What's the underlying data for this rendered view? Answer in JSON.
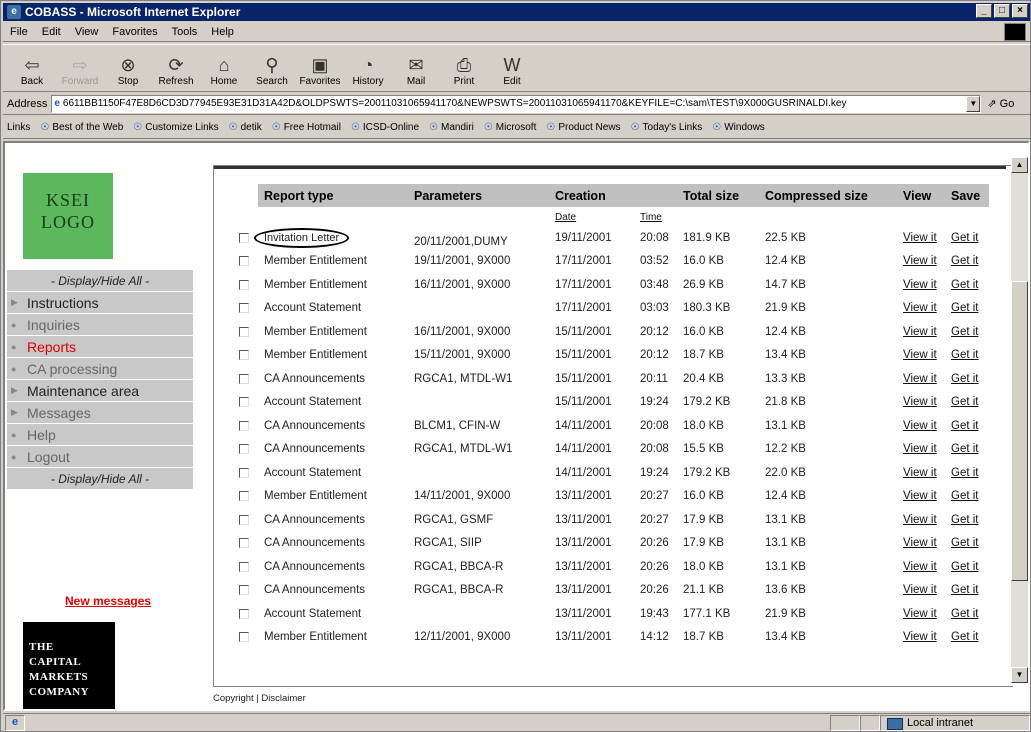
{
  "window": {
    "title": "COBASS - Microsoft Internet Explorer"
  },
  "menubar": [
    "File",
    "Edit",
    "View",
    "Favorites",
    "Tools",
    "Help"
  ],
  "toolbar": {
    "back": "Back",
    "forward": "Forward",
    "stop": "Stop",
    "refresh": "Refresh",
    "home": "Home",
    "search": "Search",
    "favorites": "Favorites",
    "history": "History",
    "mail": "Mail",
    "print": "Print",
    "edit": "Edit"
  },
  "address": {
    "label": "Address",
    "url": "6611BB1150F47E8D6CD3D77945E93E31D31A42D&OLDPSWTS=20011031065941170&NEWPSWTS=20011031065941170&KEYFILE=C:\\sam\\TEST\\9X000GUSRINALDI.key",
    "go": "Go"
  },
  "links": {
    "label": "Links",
    "items": [
      "Best of the Web",
      "Customize Links",
      "detik",
      "Free Hotmail",
      "ICSD-Online",
      "Mandiri",
      "Microsoft",
      "Product News",
      "Today's Links",
      "Windows"
    ]
  },
  "sidebar": {
    "logo": "KSEI LOGO",
    "display_hide_top": "- Display/Hide All -",
    "display_hide_bottom": "- Display/Hide All -",
    "items": [
      {
        "label": "Instructions",
        "bullet": "arrow"
      },
      {
        "label": "Inquiries",
        "bullet": "dot"
      },
      {
        "label": "Reports",
        "bullet": "dot",
        "active": true
      },
      {
        "label": "CA processing",
        "bullet": "dot"
      },
      {
        "label": "Maintenance area",
        "bullet": "arrow"
      },
      {
        "label": "Messages",
        "bullet": "arrow"
      },
      {
        "label": "Help",
        "bullet": "dot"
      },
      {
        "label": "Logout",
        "bullet": "dot"
      }
    ],
    "new_messages": "New messages",
    "company": [
      "THE",
      "CAPITAL",
      "MARKETS",
      "COMPANY"
    ]
  },
  "table": {
    "headers": {
      "report_type": "Report type",
      "parameters": "Parameters",
      "creation": "Creation",
      "total_size": "Total size",
      "compressed_size": "Compressed size",
      "view": "View",
      "save": "Save"
    },
    "subheaders": {
      "date": "Date",
      "time": "Time"
    },
    "view_link": "View it",
    "save_link": "Get it",
    "rows": [
      {
        "type": "Invitation Letter",
        "params": "20/11/2001,DUMY",
        "date": "19/11/2001",
        "time": "20:08",
        "total": "181.9 KB",
        "compressed": "22.5 KB"
      },
      {
        "type": "Member Entitlement",
        "params": "19/11/2001, 9X000",
        "date": "17/11/2001",
        "time": "03:52",
        "total": "16.0 KB",
        "compressed": "12.4 KB"
      },
      {
        "type": "Member Entitlement",
        "params": "16/11/2001, 9X000",
        "date": "17/11/2001",
        "time": "03:48",
        "total": "26.9 KB",
        "compressed": "14.7 KB"
      },
      {
        "type": "Account Statement",
        "params": "",
        "date": "17/11/2001",
        "time": "03:03",
        "total": "180.3 KB",
        "compressed": "21.9 KB"
      },
      {
        "type": "Member Entitlement",
        "params": "16/11/2001, 9X000",
        "date": "15/11/2001",
        "time": "20:12",
        "total": "16.0 KB",
        "compressed": "12.4 KB"
      },
      {
        "type": "Member Entitlement",
        "params": "15/11/2001, 9X000",
        "date": "15/11/2001",
        "time": "20:12",
        "total": "18.7 KB",
        "compressed": "13.4 KB"
      },
      {
        "type": "CA Announcements",
        "params": "RGCA1, MTDL-W1",
        "date": "15/11/2001",
        "time": "20:11",
        "total": "20.4 KB",
        "compressed": "13.3 KB"
      },
      {
        "type": "Account Statement",
        "params": "",
        "date": "15/11/2001",
        "time": "19:24",
        "total": "179.2 KB",
        "compressed": "21.8 KB"
      },
      {
        "type": "CA Announcements",
        "params": "BLCM1, CFIN-W",
        "date": "14/11/2001",
        "time": "20:08",
        "total": "18.0 KB",
        "compressed": "13.1 KB"
      },
      {
        "type": "CA Announcements",
        "params": "RGCA1, MTDL-W1",
        "date": "14/11/2001",
        "time": "20:08",
        "total": "15.5 KB",
        "compressed": "12.2 KB"
      },
      {
        "type": "Account Statement",
        "params": "",
        "date": "14/11/2001",
        "time": "19:24",
        "total": "179.2 KB",
        "compressed": "22.0 KB"
      },
      {
        "type": "Member Entitlement",
        "params": "14/11/2001, 9X000",
        "date": "13/11/2001",
        "time": "20:27",
        "total": "16.0 KB",
        "compressed": "12.4 KB"
      },
      {
        "type": "CA Announcements",
        "params": "RGCA1, GSMF",
        "date": "13/11/2001",
        "time": "20:27",
        "total": "17.9 KB",
        "compressed": "13.1 KB"
      },
      {
        "type": "CA Announcements",
        "params": "RGCA1, SIIP",
        "date": "13/11/2001",
        "time": "20:26",
        "total": "17.9 KB",
        "compressed": "13.1 KB"
      },
      {
        "type": "CA Announcements",
        "params": "RGCA1, BBCA-R",
        "date": "13/11/2001",
        "time": "20:26",
        "total": "18.0 KB",
        "compressed": "13.1 KB"
      },
      {
        "type": "CA Announcements",
        "params": "RGCA1, BBCA-R",
        "date": "13/11/2001",
        "time": "20:26",
        "total": "21.1 KB",
        "compressed": "13.6 KB"
      },
      {
        "type": "Account Statement",
        "params": "",
        "date": "13/11/2001",
        "time": "19:43",
        "total": "177.1 KB",
        "compressed": "21.9 KB"
      },
      {
        "type": "Member Entitlement",
        "params": "12/11/2001, 9X000",
        "date": "13/11/2001",
        "time": "14:12",
        "total": "18.7 KB",
        "compressed": "13.4 KB"
      }
    ]
  },
  "footer": {
    "copyright": "Copyright",
    "separator": "|",
    "disclaimer": "Disclaimer"
  },
  "status": {
    "zone": "Local intranet"
  }
}
